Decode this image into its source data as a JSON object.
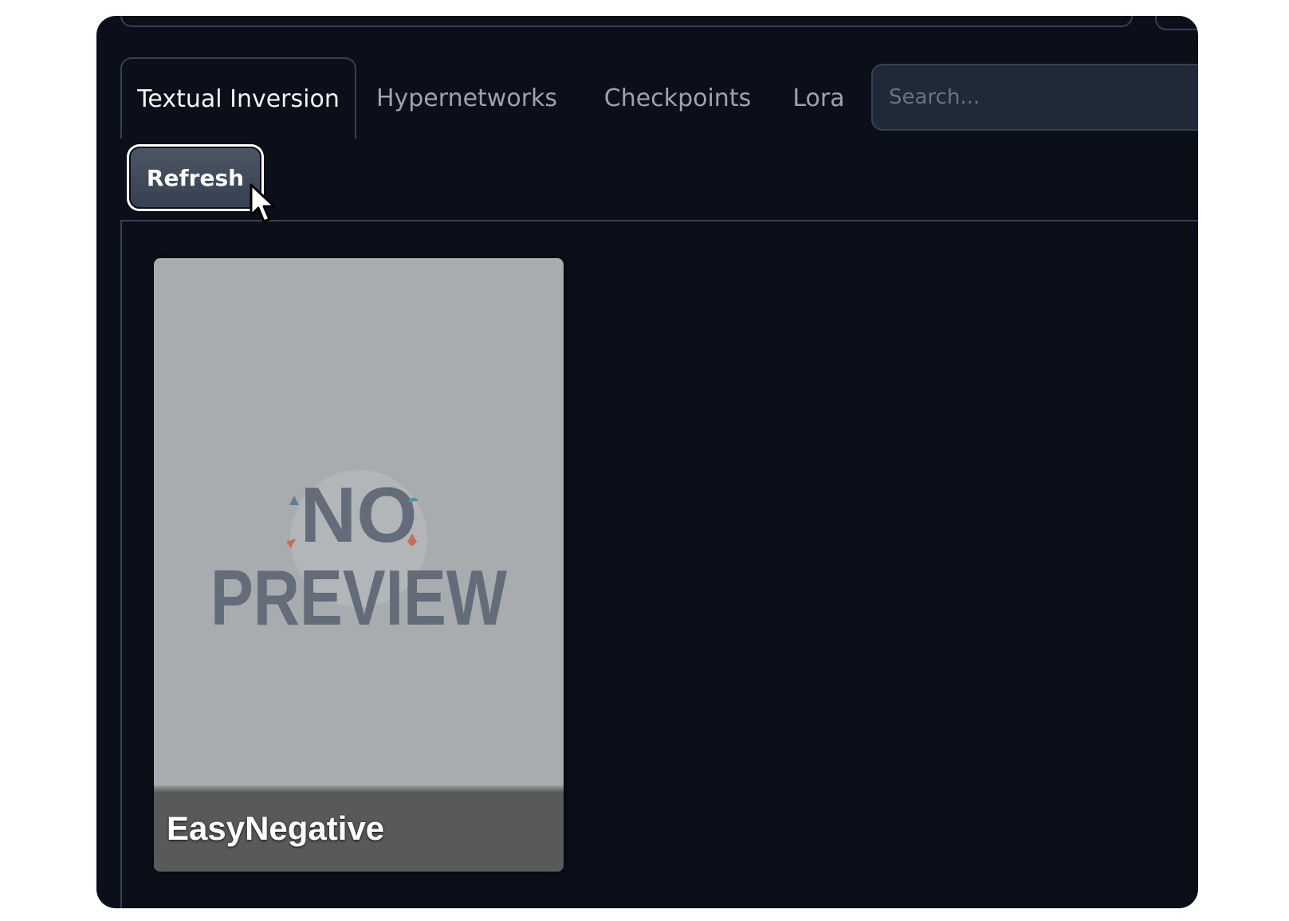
{
  "tabs": [
    {
      "label": "Textual Inversion",
      "active": true
    },
    {
      "label": "Hypernetworks",
      "active": false
    },
    {
      "label": "Checkpoints",
      "active": false
    },
    {
      "label": "Lora",
      "active": false
    }
  ],
  "search": {
    "placeholder": "Search..."
  },
  "refresh": {
    "label": "Refresh"
  },
  "cards": [
    {
      "title": "EasyNegative",
      "preview": {
        "line1": "NO",
        "line2": "PREVIEW"
      }
    }
  ],
  "colors": {
    "background": "#0b0f19",
    "border": "#374151",
    "search_bg": "#1f2937",
    "card_bg": "#a9acae",
    "preview_text": "#6b7280"
  },
  "icons": {
    "cursor": "mouse-pointer-icon"
  }
}
